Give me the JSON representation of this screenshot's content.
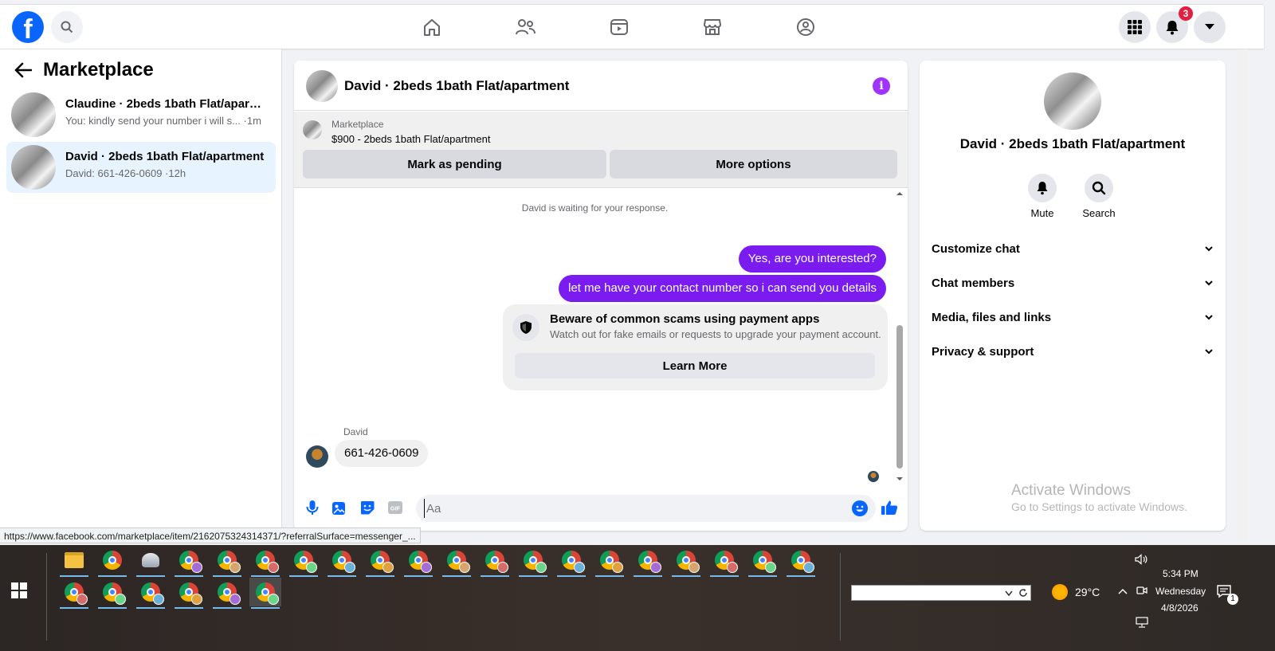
{
  "topbar": {
    "logo": "f",
    "nav_icons": [
      "home-icon",
      "friends-icon",
      "video-icon",
      "marketplace-icon",
      "groups-icon"
    ],
    "notification_count": "3"
  },
  "sidebar": {
    "title": "Marketplace",
    "conversations": [
      {
        "name": "Claudine · 2beds 1bath Flat/apartment",
        "preview": "You: kindly send your number i will s... ·1m",
        "active": false
      },
      {
        "name": "David · 2beds 1bath Flat/apartment",
        "preview": "David: 661-426-0609 ·12h",
        "active": true
      }
    ]
  },
  "chat": {
    "title": "David · 2beds 1bath Flat/apartment",
    "info_glyph": "i",
    "marketplace": {
      "label": "Marketplace",
      "item": "$900 - 2beds 1bath Flat/apartment",
      "pending_label": "Mark as pending",
      "more_label": "More options"
    },
    "waiting": "David is waiting for your response.",
    "outgoing": [
      "Yes, are you interested?",
      "let me have your contact number so i can send you details"
    ],
    "scam_card": {
      "title": "Beware of common scams using payment apps",
      "subtitle": "Watch out for fake emails or requests to upgrade your payment account.",
      "button": "Learn More"
    },
    "incoming": {
      "sender": "David",
      "message": "661-426-0609"
    },
    "composer_placeholder": "Aa"
  },
  "info_panel": {
    "name": "David · 2beds 1bath Flat/apartment",
    "actions": [
      {
        "label": "Mute"
      },
      {
        "label": "Search"
      }
    ],
    "sections": [
      "Customize chat",
      "Chat members",
      "Media, files and links",
      "Privacy & support"
    ],
    "activate_title": "Activate Windows",
    "activate_sub": "Go to Settings to activate Windows."
  },
  "statusbar": {
    "url": "https://www.facebook.com/marketplace/item/2162075324314371/?referralSurface=messenger_..."
  },
  "taskbar": {
    "temperature": "29°C",
    "time": "5:34 PM",
    "day": "Wednesday",
    "date": "4/8/2026",
    "notification_count": "1",
    "profile_colors": [
      "#a56bd6",
      "#d6a56b",
      "#d66b6b",
      "#6bd68a",
      "#6bb0d6",
      "#e0a040"
    ]
  }
}
